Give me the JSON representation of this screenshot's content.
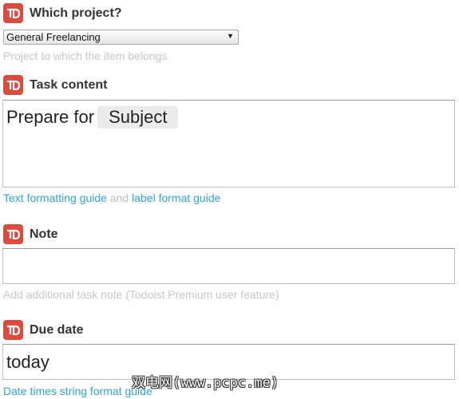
{
  "project": {
    "title": "Which project?",
    "selected": "General Freelancing",
    "helper": "Project to which the item belongs"
  },
  "task": {
    "title": "Task content",
    "text": "Prepare for",
    "chip": "Subject",
    "link1": "Text formatting guide",
    "and": "and",
    "link2": "label format guide"
  },
  "note": {
    "title": "Note",
    "helper": "Add additional task note (Todoist Premium user feature)"
  },
  "due": {
    "title": "Due date",
    "value": "today",
    "helper": "Date times string format guide"
  },
  "watermark": "双电网(www.pcpc.me)",
  "icons": {
    "app": "todoist-icon",
    "dropdown": "dropdown-arrow-icon"
  },
  "colors": {
    "brand": "#db4c3f",
    "link": "#2ba6de",
    "helper": "#c8c8c8"
  }
}
